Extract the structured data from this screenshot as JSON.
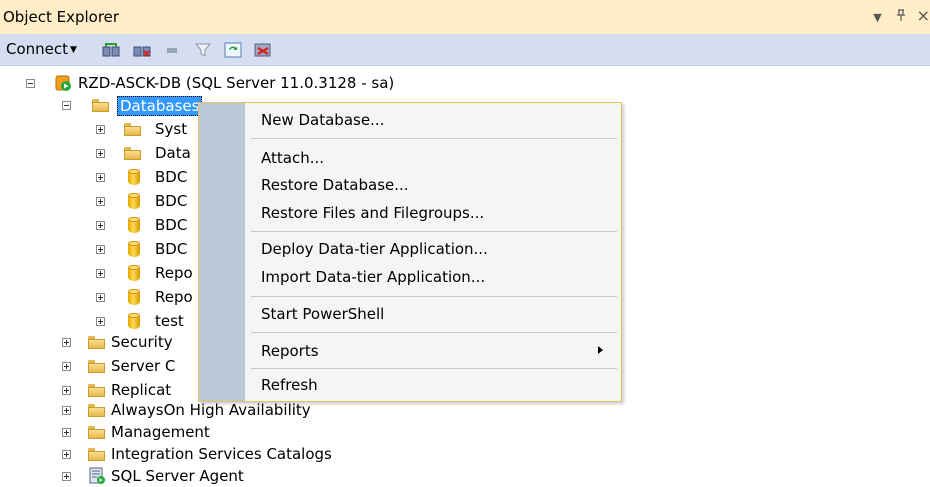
{
  "window": {
    "title": "Object Explorer",
    "pin_glyph": "▾",
    "autohide_glyph": "ᵖ",
    "close_glyph": "×"
  },
  "toolbar": {
    "connect_label": "Connect",
    "connect_caret": "▼",
    "icons": [
      "connect-object-explorer-icon",
      "disconnect-icon",
      "stop-icon",
      "filter-icon",
      "refresh-icon",
      "start-powershell-icon"
    ]
  },
  "tree": {
    "server": "RZD-ASCK-DB (SQL Server 11.0.3128 - sa)",
    "databases_folder": "Databases",
    "databases_children": [
      "Syst",
      "Data",
      "BDC",
      "BDC",
      "BDC",
      "BDC",
      "Repo",
      "Repo",
      "test"
    ],
    "server_children": [
      "Security",
      "Server C",
      "Replicat",
      "AlwaysOn High Availability",
      "Management",
      "Integration Services Catalogs",
      "SQL Server Agent"
    ]
  },
  "context_menu": {
    "items": [
      {
        "label": "New Database..."
      },
      {
        "label": "Attach..."
      },
      {
        "label": "Restore Database..."
      },
      {
        "label": "Restore Files and Filegroups..."
      },
      {
        "label": "Deploy Data-tier Application..."
      },
      {
        "label": "Import Data-tier Application..."
      },
      {
        "label": "Start PowerShell"
      },
      {
        "label": "Reports"
      },
      {
        "label": "Refresh"
      }
    ]
  }
}
